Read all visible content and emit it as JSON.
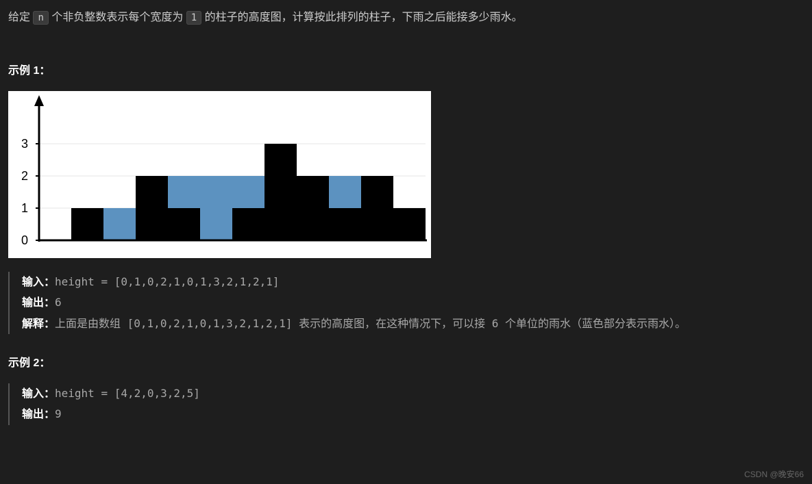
{
  "description": {
    "prefix": "给定 ",
    "code1": "n",
    "mid": " 个非负整数表示每个宽度为 ",
    "code2": "1",
    "suffix": " 的柱子的高度图，计算按此排列的柱子，下雨之后能接多少雨水。"
  },
  "examples": [
    {
      "title": "示例 1：",
      "hasChart": true,
      "input_label": "输入：",
      "input_value": "height = [0,1,0,2,1,0,1,3,2,1,2,1]",
      "output_label": "输出：",
      "output_value": "6",
      "explain_label": "解释：",
      "explain_value": "上面是由数组 [0,1,0,2,1,0,1,3,2,1,2,1] 表示的高度图，在这种情况下，可以接 6 个单位的雨水（蓝色部分表示雨水）。 "
    },
    {
      "title": "示例 2：",
      "hasChart": false,
      "input_label": "输入：",
      "input_value": "height = [4,2,0,3,2,5]",
      "output_label": "输出：",
      "output_value": "9"
    }
  ],
  "chart_data": {
    "type": "bar",
    "heights": [
      0,
      1,
      0,
      2,
      1,
      0,
      1,
      3,
      2,
      1,
      2,
      1
    ],
    "water": [
      0,
      0,
      1,
      0,
      1,
      2,
      1,
      0,
      0,
      1,
      0,
      0
    ],
    "y_ticks": [
      "0",
      "1",
      "2",
      "3"
    ],
    "ylim": [
      0,
      3
    ],
    "bar_color": "#000000",
    "water_color": "#5c92c0"
  },
  "watermark": "CSDN @晚安66"
}
